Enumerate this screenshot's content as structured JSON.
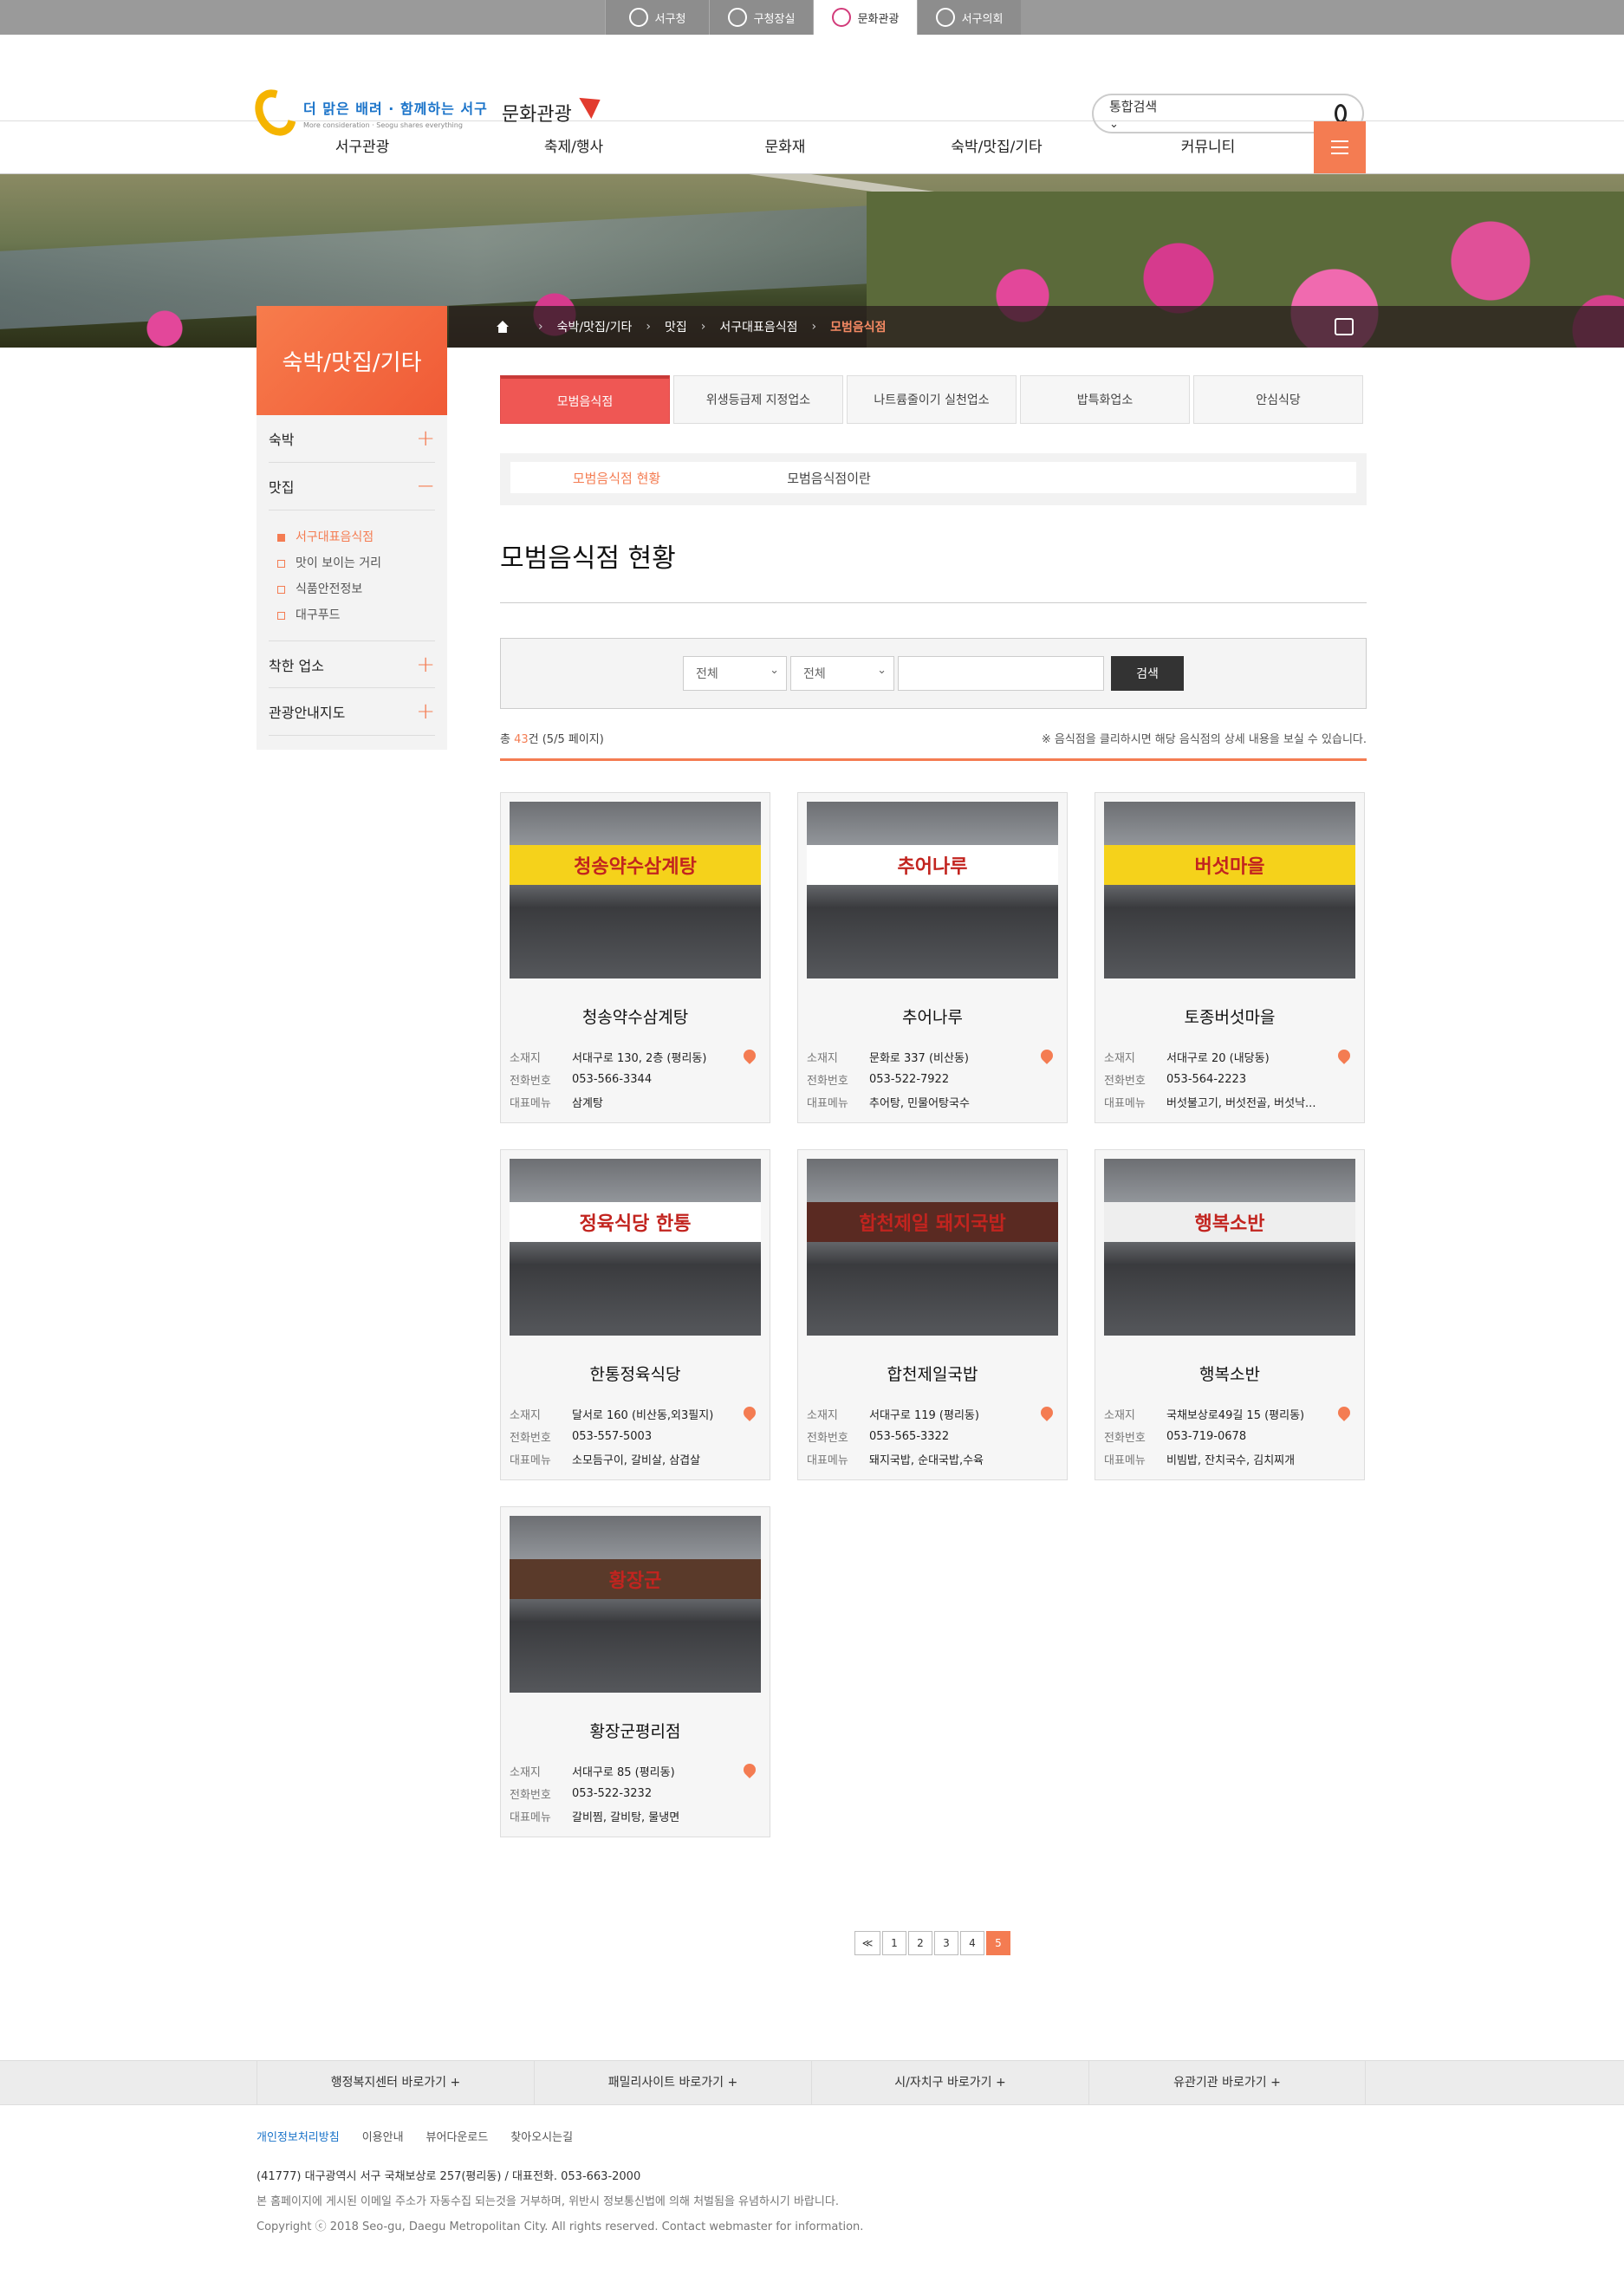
{
  "topbar": {
    "tabs": [
      {
        "label": "서구청",
        "icon": "globe-icon"
      },
      {
        "label": "구청장실",
        "icon": "sprout-icon"
      },
      {
        "label": "문화관광",
        "icon": "star-icon"
      },
      {
        "label": "서구의회",
        "icon": "seal-icon"
      }
    ],
    "active": "문화관광"
  },
  "header": {
    "logo_text": "더 맑은 배려 · 함께하는 서구",
    "logo_sub": "More consideration · Seogu shares everything",
    "logo_title": "문화관광",
    "search": {
      "select": "통합검색",
      "placeholder": ""
    }
  },
  "gnb": {
    "items": [
      "서구관광",
      "축제/행사",
      "문화재",
      "숙박/맛집/기타",
      "커뮤니티"
    ]
  },
  "breadcrumb": {
    "items": [
      "숙박/맛집/기타",
      "맛집",
      "서구대표음식점"
    ],
    "current": "모범음식점"
  },
  "side": {
    "title": "숙박/맛집/기타",
    "items": [
      {
        "label": "숙박",
        "toggle": "+"
      },
      {
        "label": "맛집",
        "toggle": "−"
      }
    ],
    "sub": [
      "서구대표음식점",
      "맛이 보이는 거리",
      "식품안전정보",
      "대구푸드"
    ],
    "items2": [
      {
        "label": "착한 업소",
        "toggle": "+"
      },
      {
        "label": "관광안내지도",
        "toggle": "+"
      }
    ]
  },
  "tabs": [
    "모범음식점",
    "위생등급제 지정업소",
    "나트륨줄이기 실천업소",
    "밥특화업소",
    "안심식당"
  ],
  "subtabs": [
    "모범음식점 현황",
    "모범음식점이란"
  ],
  "page_title": "모범음식점 현황",
  "search_box": {
    "sel1": "전체",
    "sel2": "전체",
    "button": "검색"
  },
  "count": {
    "prefix": "총 ",
    "n": "43",
    "suffix": "건 (5/5 페이지)",
    "note": "※ 음식점을 클리하시면 해당 음식점의 상세 내용을 보실 수 있습니다."
  },
  "labels": {
    "addr": "소재지",
    "tel": "전화번호",
    "menu": "대표메뉴"
  },
  "cards": [
    {
      "name": "청송약수삼계탕",
      "addr": "서대구로 130, 2층 (평리동)",
      "tel": "053-566-3344",
      "menu": "삼계탕",
      "sign": "청송약수삼계탕",
      "sign_color": "#f5d21b"
    },
    {
      "name": "추어나루",
      "addr": "문화로 337 (비산동)",
      "tel": "053-522-7922",
      "menu": "추어탕, 민물어탕국수",
      "sign": "추어나루",
      "sign_color": "#ffffff"
    },
    {
      "name": "토종버섯마을",
      "addr": "서대구로 20 (내당동)",
      "tel": "053-564-2223",
      "menu": "버섯불고기, 버섯전골, 버섯낙...",
      "sign": "버섯마을",
      "sign_color": "#f5d21b"
    },
    {
      "name": "한통정육식당",
      "addr": "달서로 160 (비산동,외3필지)",
      "tel": "053-557-5003",
      "menu": "소모듬구이, 갈비살, 삼겹살",
      "sign": "정육식당 한통",
      "sign_color": "#ffffff"
    },
    {
      "name": "합천제일국밥",
      "addr": "서대구로 119 (평리동)",
      "tel": "053-565-3322",
      "menu": "돼지국밥, 순대국밥,수육",
      "sign": "합천제일 돼지국밥",
      "sign_color": "#5a2a22"
    },
    {
      "name": "행복소반",
      "addr": "국채보상로49길 15 (평리동)",
      "tel": "053-719-0678",
      "menu": "비빔밥, 잔치국수, 김치찌개",
      "sign": "행복소반",
      "sign_color": "#eeeeee"
    },
    {
      "name": "황장군평리점",
      "addr": "서대구로 85 (평리동)",
      "tel": "053-522-3232",
      "menu": "갈비찜, 갈비탕, 물냉면",
      "sign": "황장군",
      "sign_color": "#5a3a2a"
    }
  ],
  "pager": {
    "prev": "≪",
    "pages": [
      "1",
      "2",
      "3",
      "4",
      "5"
    ],
    "current": "5"
  },
  "foot_links": [
    "행정복지센터 바로가기 +",
    "패밀리사이트 바로가기 +",
    "시/자치구 바로가기 +",
    "유관기관 바로가기 +"
  ],
  "footer": {
    "links": [
      "개인정보처리방침",
      "이용안내",
      "뷰어다운로드",
      "찾아오시는길"
    ],
    "addr": "(41777) 대구광역시 서구 국채보상로 257(평리동) / 대표전화. 053-663-2000",
    "notice": "본 홈페이지에 게시된 이메일 주소가 자동수집 되는것을 거부하며, 위반시 정보통신법에 의해 처벌됨을 유념하시기 바랍니다.",
    "copy": "Copyright ⓒ 2018 Seo-gu, Daegu Metropolitan City. All rights reserved. Contact webmaster for information."
  }
}
